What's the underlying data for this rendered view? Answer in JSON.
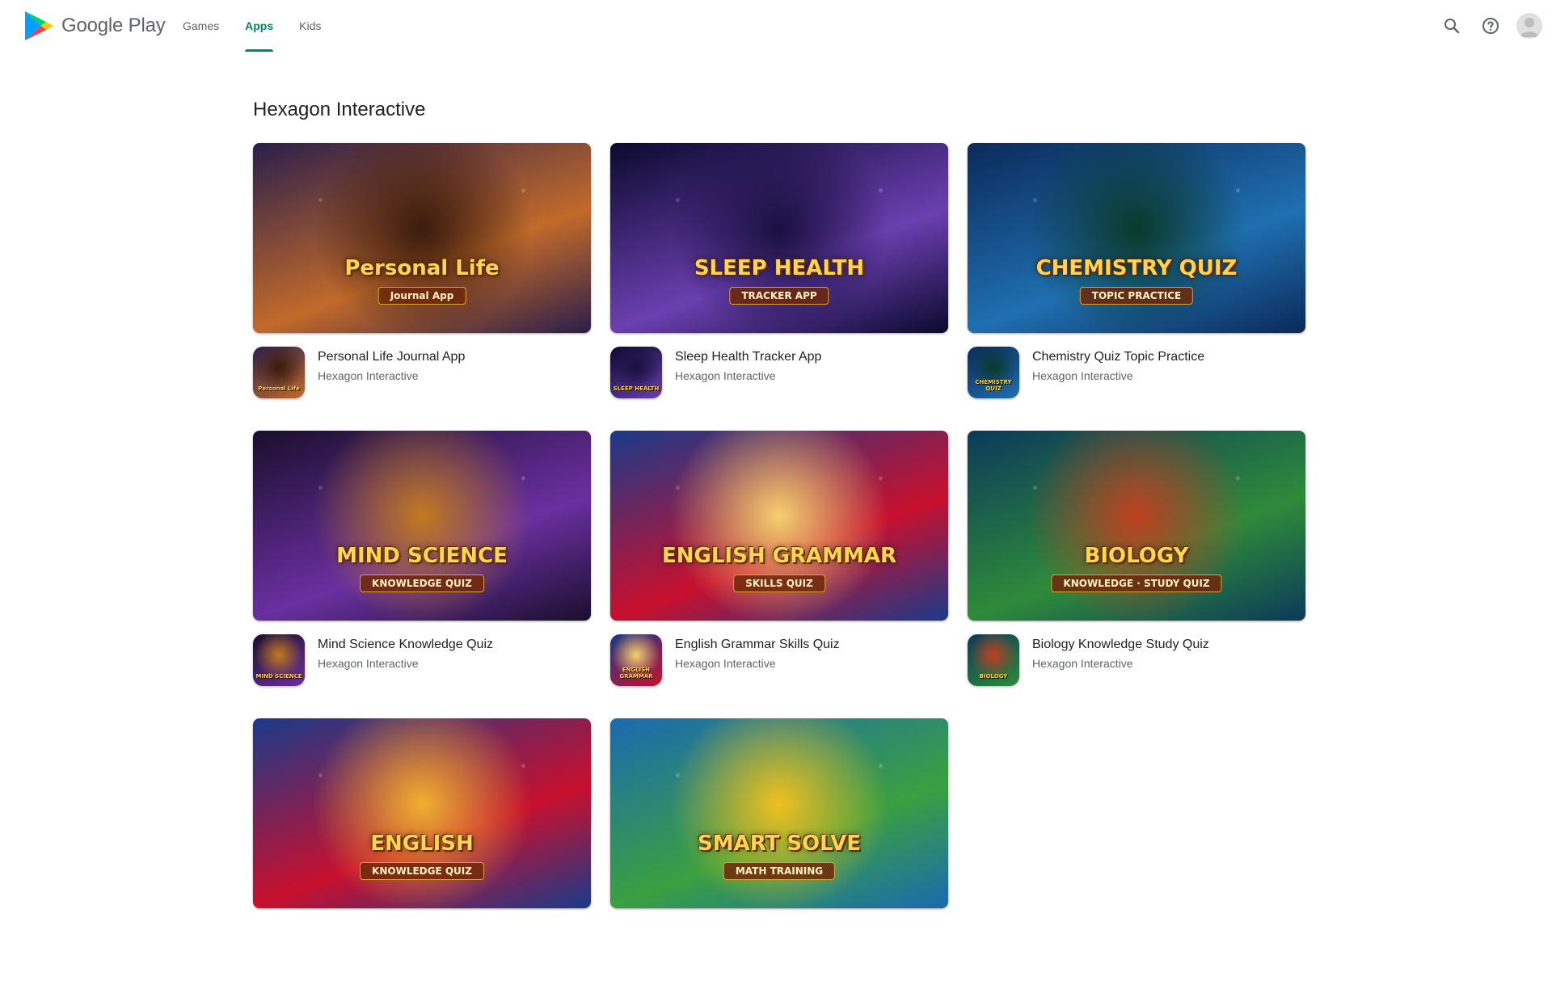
{
  "header": {
    "brand": "Google Play",
    "logo_icon": "google-play-logo",
    "tabs": [
      {
        "label": "Games",
        "active": false
      },
      {
        "label": "Apps",
        "active": true
      },
      {
        "label": "Kids",
        "active": false
      }
    ],
    "actions": [
      {
        "name": "search",
        "icon": "search-icon"
      },
      {
        "name": "help",
        "icon": "help-icon"
      },
      {
        "name": "account",
        "icon": "avatar"
      }
    ]
  },
  "colors": {
    "accent": "#01875f",
    "text_primary": "#202124",
    "text_secondary": "#5f6368"
  },
  "page": {
    "title": "Hexagon Interactive"
  },
  "apps": [
    {
      "name": "Personal Life Journal App",
      "developer": "Hexagon Interactive",
      "banner_title": "Personal Life",
      "banner_subtitle": "Journal App",
      "theme": {
        "bg1": "#2b1e4a",
        "bg2": "#c26a2a",
        "bg3": "#3a1b0c"
      }
    },
    {
      "name": "Sleep Health Tracker App",
      "developer": "Hexagon Interactive",
      "banner_title": "SLEEP HEALTH",
      "banner_subtitle": "TRACKER APP",
      "theme": {
        "bg1": "#0a0a2e",
        "bg2": "#6b3fb0",
        "bg3": "#1a1040"
      }
    },
    {
      "name": "Chemistry Quiz Topic Practice",
      "developer": "Hexagon Interactive",
      "banner_title": "CHEMISTRY QUIZ",
      "banner_subtitle": "TOPIC PRACTICE",
      "theme": {
        "bg1": "#0b2a5a",
        "bg2": "#1f6fb0",
        "bg3": "#0a3a2a"
      }
    },
    {
      "name": "Mind Science Knowledge Quiz",
      "developer": "Hexagon Interactive",
      "banner_title": "MIND SCIENCE",
      "banner_subtitle": "KNOWLEDGE QUIZ",
      "theme": {
        "bg1": "#1a0f2e",
        "bg2": "#6a2fa0",
        "bg3": "#c27a20"
      }
    },
    {
      "name": "English Grammar Skills Quiz",
      "developer": "Hexagon Interactive",
      "banner_title": "ENGLISH GRAMMAR",
      "banner_subtitle": "SKILLS QUIZ",
      "theme": {
        "bg1": "#1a3a8a",
        "bg2": "#c8102e",
        "bg3": "#f5d070"
      }
    },
    {
      "name": "Biology Knowledge Study Quiz",
      "developer": "Hexagon Interactive",
      "banner_title": "BIOLOGY",
      "banner_subtitle": "KNOWLEDGE · STUDY QUIZ",
      "theme": {
        "bg1": "#0b3a5a",
        "bg2": "#2e8b3a",
        "bg3": "#c04020"
      }
    },
    {
      "name": "",
      "developer": "",
      "banner_title": "ENGLISH",
      "banner_subtitle": "KNOWLEDGE QUIZ",
      "theme": {
        "bg1": "#1a3a8a",
        "bg2": "#c8102e",
        "bg3": "#f0b030"
      }
    },
    {
      "name": "",
      "developer": "",
      "banner_title": "SMART SOLVE",
      "banner_subtitle": "MATH TRAINING",
      "theme": {
        "bg1": "#1a6ab0",
        "bg2": "#3aa040",
        "bg3": "#f0c020"
      }
    }
  ]
}
